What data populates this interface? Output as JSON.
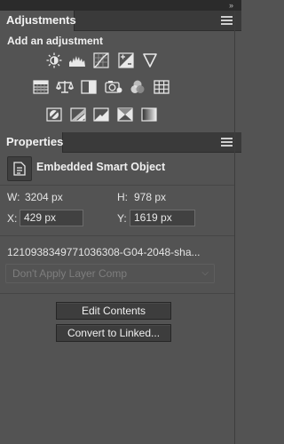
{
  "adjustments": {
    "tab_label": "Adjustments",
    "subtitle": "Add an adjustment",
    "icons": [
      "brightness-contrast-icon",
      "levels-icon",
      "curves-icon",
      "exposure-icon",
      "vibrance-icon",
      "hue-saturation-icon",
      "color-balance-icon",
      "black-white-icon",
      "photo-filter-icon",
      "channel-mixer-icon",
      "color-lookup-icon",
      "invert-icon",
      "posterize-icon",
      "threshold-icon",
      "selective-color-icon",
      "gradient-map-icon"
    ]
  },
  "properties": {
    "tab_label": "Properties",
    "title": "Embedded Smart Object",
    "w_label": "W:",
    "w_value": "3204 px",
    "h_label": "H:",
    "h_value": "978 px",
    "x_label": "X:",
    "x_value": "429 px",
    "y_label": "Y:",
    "y_value": "1619 px",
    "filename": "1210938349771036308-G04-2048-sha...",
    "layer_comp": "Don't Apply Layer Comp",
    "edit_contents": "Edit Contents",
    "convert_linked": "Convert to Linked..."
  },
  "colors": {
    "panel_bg": "#535353",
    "tab_bar": "#3a3a3a",
    "top_strip": "#2b2b2b"
  }
}
